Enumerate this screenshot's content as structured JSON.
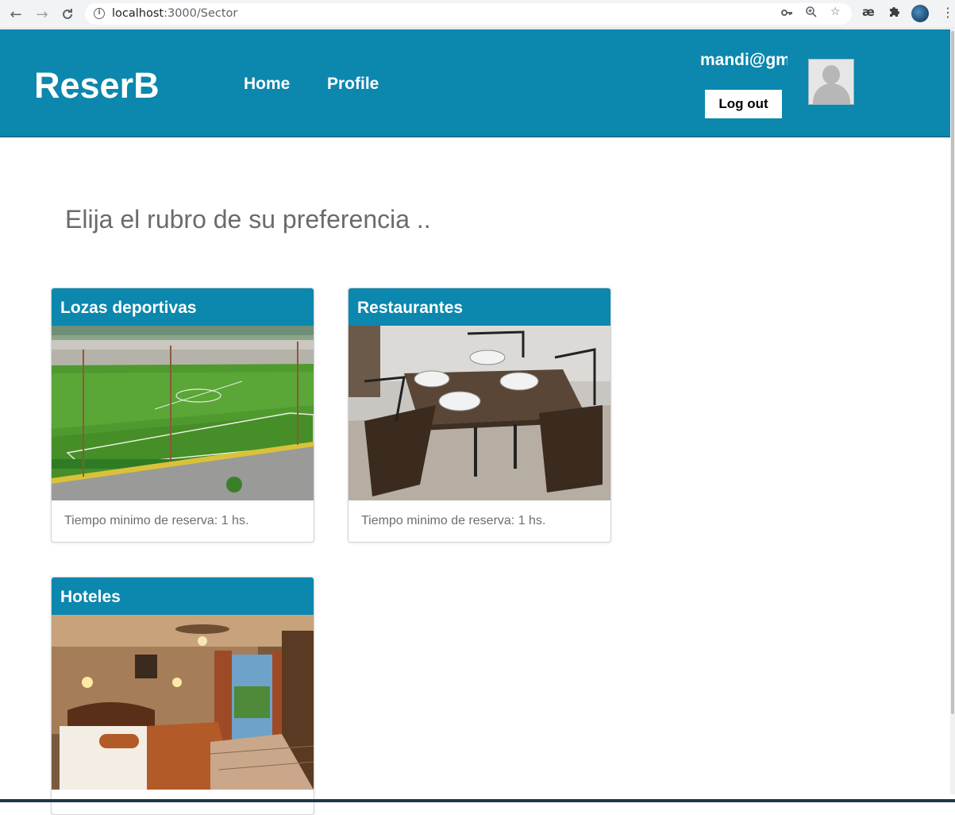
{
  "browser": {
    "url_host": "localhost",
    "url_path": ":3000/Sector",
    "icons": [
      "back-icon",
      "forward-icon",
      "reload-icon",
      "info-icon",
      "key-icon",
      "zoom-icon",
      "star-icon",
      "extension-ae-icon",
      "puzzle-icon",
      "profile-icon",
      "menu-icon"
    ]
  },
  "header": {
    "brand": "ReserB",
    "nav": {
      "home": "Home",
      "profile": "Profile"
    },
    "user_email": "mandi@gm",
    "logout_label": "Log out",
    "accent_color": "#0c87ad"
  },
  "main": {
    "heading": "Elija el rubro de su preferencia ..",
    "cards": [
      {
        "title": "Lozas deportivas",
        "image": "soccer-field-image",
        "footer": "Tiempo minimo de reserva: 1 hs."
      },
      {
        "title": "Restaurantes",
        "image": "dining-table-image",
        "footer": "Tiempo minimo de reserva: 1 hs."
      },
      {
        "title": "Hoteles",
        "image": "hotel-room-image",
        "footer": ""
      }
    ]
  }
}
